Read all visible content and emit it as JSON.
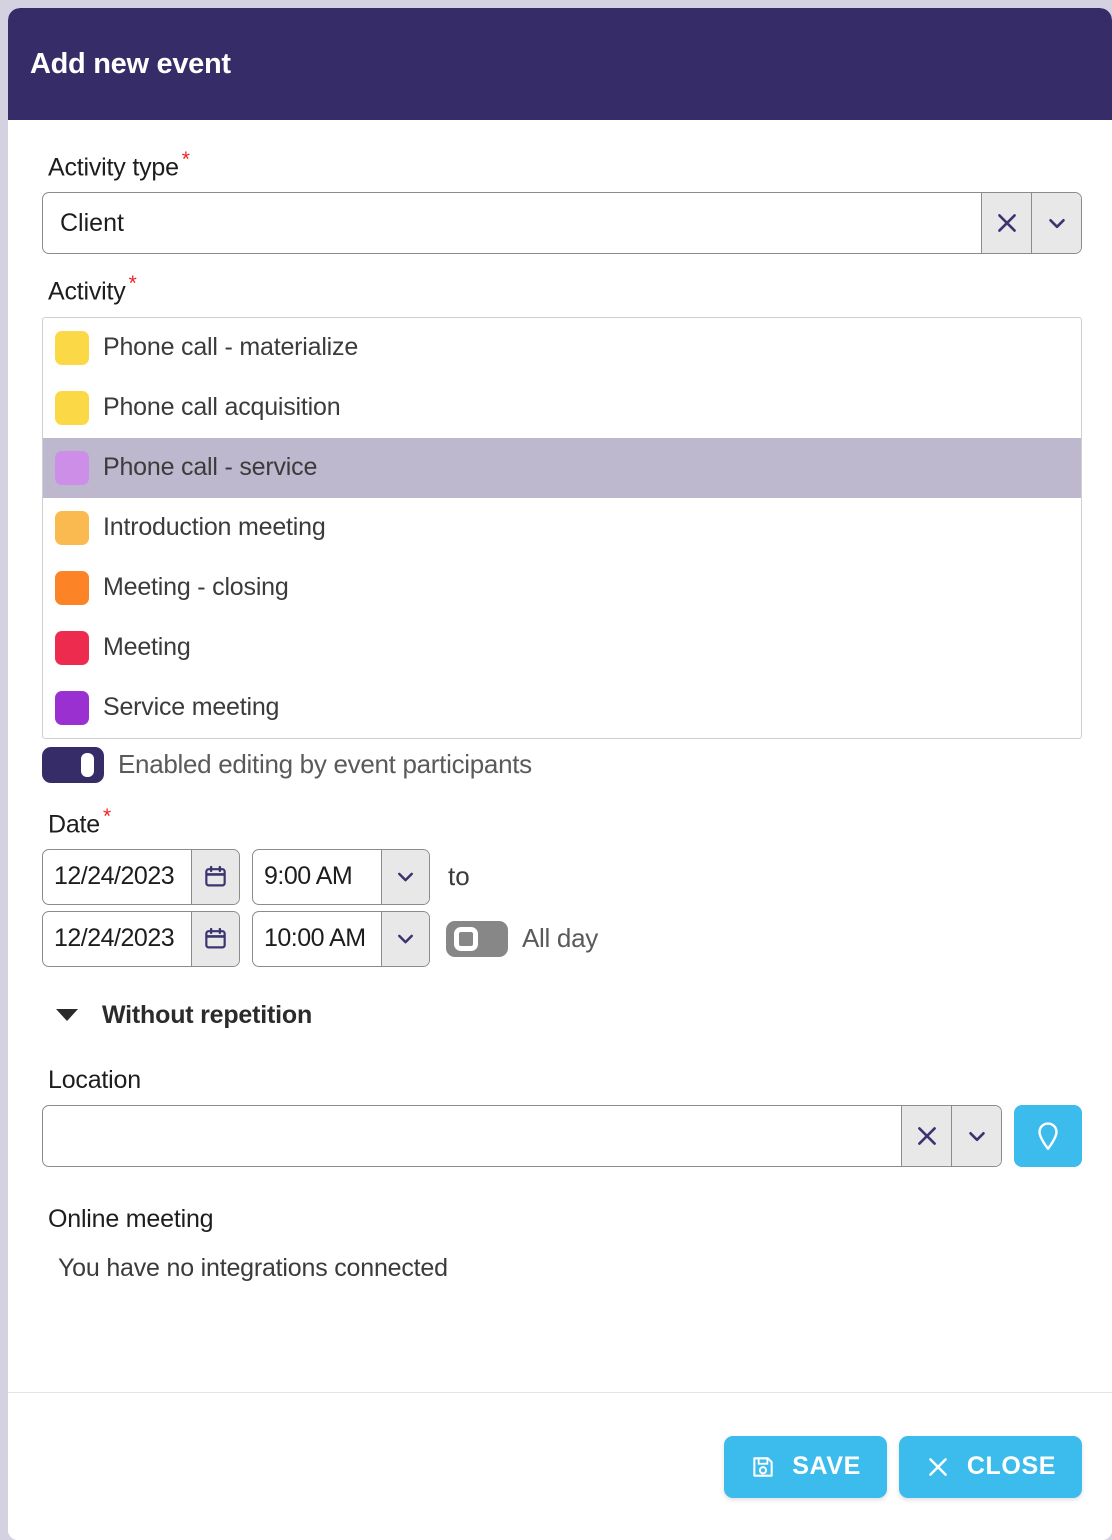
{
  "header": {
    "title": "Add new event"
  },
  "activity_type": {
    "label": "Activity type",
    "required_mark": "*",
    "value": "Client",
    "clear_icon": "close-x-icon",
    "dropdown_icon": "chevron-down-icon"
  },
  "activity": {
    "label": "Activity",
    "required_mark": "*",
    "items": [
      {
        "label": "Phone call - materialize",
        "color": "#fbd946",
        "selected": false
      },
      {
        "label": "Phone call acquisition",
        "color": "#fbd946",
        "selected": false
      },
      {
        "label": "Phone call - service",
        "color": "#cd8ee8",
        "selected": true
      },
      {
        "label": "Introduction meeting",
        "color": "#fbba4f",
        "selected": false
      },
      {
        "label": "Meeting - closing",
        "color": "#fc8326",
        "selected": false
      },
      {
        "label": "Meeting",
        "color": "#ec2b4f",
        "selected": false
      },
      {
        "label": "Service meeting",
        "color": "#9b30d0",
        "selected": false
      }
    ]
  },
  "editing_toggle": {
    "label": "Enabled editing by event participants",
    "state": "on"
  },
  "date": {
    "label": "Date",
    "required_mark": "*",
    "start_date": "12/24/2023",
    "start_time": "9:00 AM",
    "end_date": "12/24/2023",
    "end_time": "10:00 AM",
    "separator": "to",
    "calendar_icon": "calendar-icon",
    "time_dropdown_icon": "chevron-down-icon",
    "all_day": {
      "label": "All day",
      "state": "off"
    }
  },
  "repetition": {
    "label": "Without repetition",
    "caret_icon": "caret-down-icon"
  },
  "location": {
    "label": "Location",
    "value": "",
    "placeholder": "",
    "clear_icon": "close-x-icon",
    "dropdown_icon": "chevron-down-icon",
    "map_icon": "map-pin-icon"
  },
  "online_meeting": {
    "label": "Online meeting",
    "note": "You have no integrations connected"
  },
  "footer": {
    "save_label": "SAVE",
    "save_icon": "floppy-disk-icon",
    "close_label": "CLOSE",
    "close_icon": "close-x-icon"
  },
  "colors": {
    "header_bg": "#352c68",
    "accent": "#3cbced",
    "page_bg": "#d4d2e0",
    "selected_row": "#bdb8cd",
    "required": "#ef2222"
  }
}
